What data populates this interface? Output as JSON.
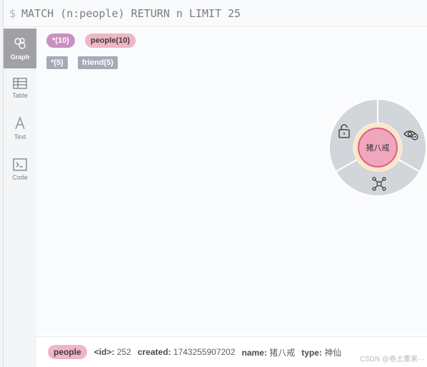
{
  "query": {
    "prompt": "$",
    "text": "MATCH (n:people) RETURN n LIMIT 25"
  },
  "sidebar": {
    "items": [
      {
        "label": "Graph",
        "icon": "graph-icon",
        "active": true
      },
      {
        "label": "Table",
        "icon": "table-icon",
        "active": false
      },
      {
        "label": "Text",
        "icon": "text-icon",
        "active": false
      },
      {
        "label": "Code",
        "icon": "code-icon",
        "active": false
      }
    ]
  },
  "labels": {
    "nodes": [
      {
        "text": "*(10)"
      },
      {
        "text": "people(10)"
      }
    ],
    "relationships": [
      {
        "text": "*(5)"
      },
      {
        "text": "friend(5)"
      }
    ]
  },
  "node": {
    "caption": "猪八戒"
  },
  "status": {
    "label": "people",
    "props": [
      {
        "key": "<id>:",
        "value": "252"
      },
      {
        "key": "created:",
        "value": "1743255907202"
      },
      {
        "key": "name:",
        "value": "猪八戒"
      },
      {
        "key": "type:",
        "value": "神仙"
      }
    ]
  },
  "watermark": "CSDN @卷土重来···",
  "colors": {
    "node_fill": "#f0a7bd",
    "node_border": "#d95f8a",
    "halo": "#fbe7c6",
    "ring": "#d2d5d9",
    "all_pill": "#c990c0",
    "people_pill": "#f0b6c5",
    "rel_pill": "#a5abb6"
  }
}
